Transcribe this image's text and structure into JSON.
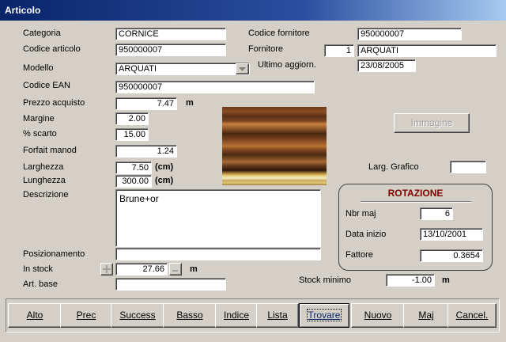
{
  "window": {
    "title": "Articolo"
  },
  "labels": {
    "categoria": "Categoria",
    "codice_articolo": "Codice articolo",
    "modello": "Modello",
    "codice_ean": "Codice EAN",
    "prezzo_acquisto": "Prezzo acquisto",
    "margine": "Margine",
    "scarto": "% scarto",
    "forfait": "Forfait manod",
    "larghezza": "Larghezza",
    "lunghezza": "Lunghezza",
    "descrizione": "Descrizione",
    "posizionamento": "Posizionamento",
    "in_stock": "In stock",
    "art_base": "Art. base",
    "codice_fornitore": "Codice fornitore",
    "fornitore": "Fornitore",
    "ultimo_aggiorn": "Ultimo aggiorn.",
    "larg_grafico": "Larg. Grafico",
    "stock_minimo": "Stock minimo"
  },
  "fields": {
    "categoria": "CORNICE",
    "codice_articolo": "950000007",
    "modello": "ARQUATI",
    "codice_ean": "950000007",
    "prezzo_acquisto": "7.47",
    "margine": "2.00",
    "scarto": "15.00",
    "forfait": "1.24",
    "larghezza": "7.50",
    "lunghezza": "300.00",
    "descrizione": "Brune+or",
    "posizionamento": "",
    "in_stock": "27.66",
    "art_base": "",
    "codice_fornitore": "950000007",
    "fornitore_num": "1",
    "fornitore_name": "ARQUATI",
    "ultimo_aggiorn": "23/08/2005",
    "larg_grafico": "",
    "stock_minimo": "-1.00"
  },
  "units": {
    "m": "m",
    "cm": "(cm)"
  },
  "buttons": {
    "immagine": "Immagine"
  },
  "rotazione": {
    "title": "ROTAZIONE",
    "nbr_maj_label": "Nbr maj",
    "nbr_maj": "6",
    "data_inizio_label": "Data inizio",
    "data_inizio": "13/10/2001",
    "fattore_label": "Fattore",
    "fattore": "0.3654"
  },
  "nav": [
    "Alto",
    "Prec",
    "Success",
    "Basso",
    "Indice",
    "Lista",
    "Trovare",
    "Nuovo",
    "Maj",
    "Cancel."
  ],
  "icons": {
    "dropdown": "chevron-down-icon",
    "plus": "plus-icon",
    "minus": "minus-icon"
  }
}
